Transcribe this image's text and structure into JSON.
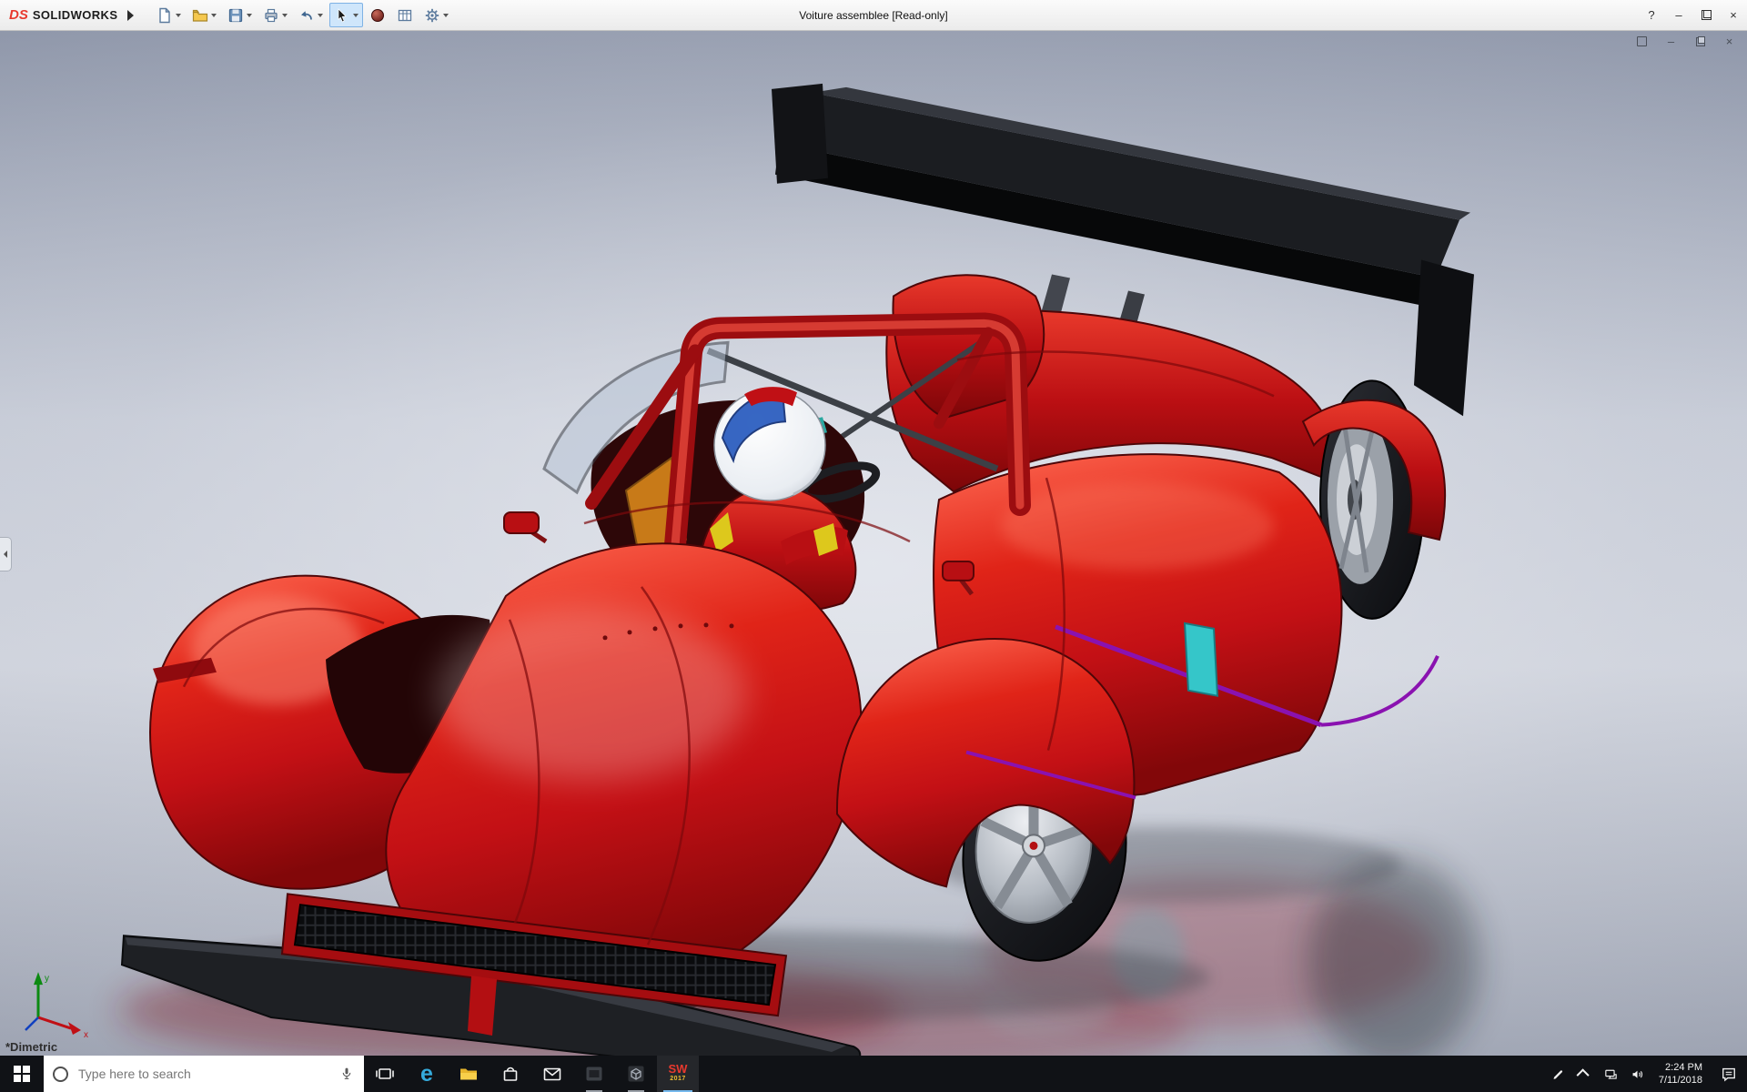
{
  "titlebar": {
    "brand_ds": "DS",
    "brand_name": "SOLIDWORKS",
    "title": "Voiture assemblee [Read-only]",
    "help_glyph": "?",
    "minimize_glyph": "–",
    "close_glyph": "×",
    "toolbar_buttons": [
      "new",
      "open",
      "save",
      "print",
      "undo",
      "select",
      "appearance-sphere",
      "evaluate-table",
      "options-gear"
    ]
  },
  "viewport": {
    "view_label": "*Dimetric",
    "doc_minimize": "–",
    "doc_close": "×",
    "triad": {
      "x": "x",
      "y": "y"
    }
  },
  "model": {
    "body_color": "#c31015",
    "wing_color": "#141518",
    "accent_purple": "#8a12b0",
    "glass_cyan": "#35c6c9",
    "rim_silver": "#b4bac2",
    "helmet_white": "#f4f6f8",
    "visor_blue": "#2d5fc0",
    "background_top": "#8e96a9",
    "background_mid": "#ccd0da"
  },
  "taskbar": {
    "search_placeholder": "Type here to search",
    "edge_glyph": "e",
    "sw_text": "SW",
    "sw_year": "2017",
    "time": "2:24 PM",
    "date": "7/11/2018"
  }
}
